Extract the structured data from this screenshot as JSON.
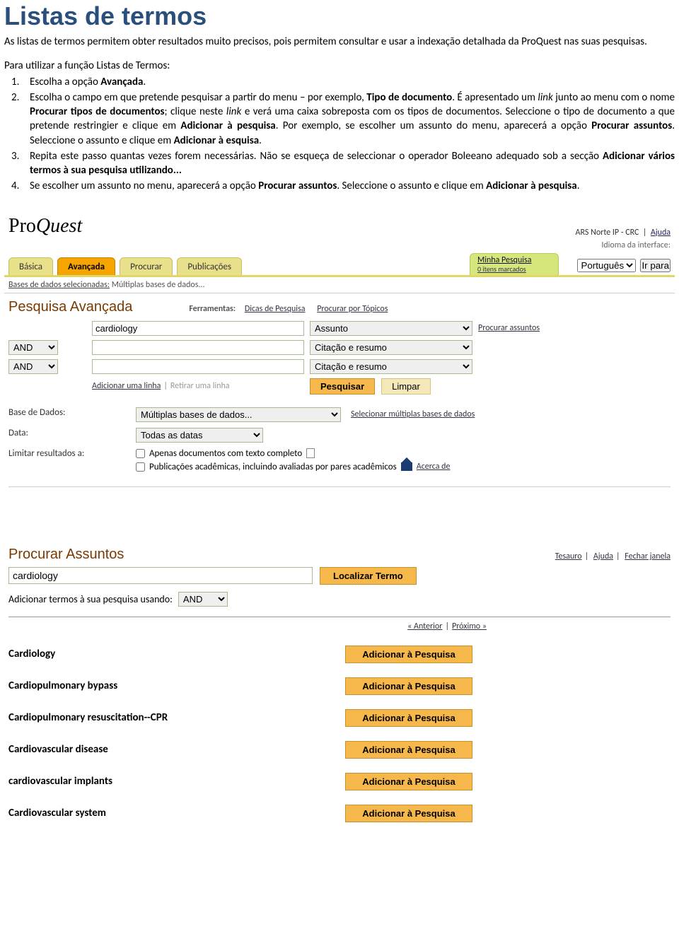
{
  "doc": {
    "title": "Listas de termos",
    "intro": "As listas de termos permitem obter resultados muito precisos, pois permitem consultar e usar a indexação detalhada da ProQuest nas suas pesquisas.",
    "lead": "Para utilizar a função Listas de Termos:",
    "steps": {
      "s1_a": "Escolha a opção ",
      "s1_b": "Avançada",
      "s1_c": ".",
      "s2_a": "Escolha o campo em que pretende pesquisar a partir do menu – por exemplo, ",
      "s2_b": "Tipo de documento",
      "s2_c": ". É apresentado um ",
      "s2_d": "link",
      "s2_e": " junto ao menu com o nome ",
      "s2_f": "Procurar tipos de documentos",
      "s2_g": "; clique neste ",
      "s2_g2": "link",
      "s2_h": " e verá uma caixa sobreposta com os tipos de documentos. Seleccione o tipo de documento a que pretende restringier e clique em ",
      "s2_i": "Adicionar à pesquisa",
      "s2_j": ". Por exemplo, se escolher um assunto do menu, aparecerá a opção ",
      "s2_k": "Procurar assuntos",
      "s2_l": ". Seleccione o assunto e clique em ",
      "s2_m": "Adicionar à esquisa",
      "s2_n": ".",
      "s3_a": "Repita este passo quantas vezes forem necessárias. Não se esqueça de seleccionar o operador Boleeano adequado sob a secção ",
      "s3_b": "Adicionar vários termos à sua pesquisa utilizando...",
      "s4_a": "Se escolher um assunto no menu, aparecerá a opção ",
      "s4_b": "Procurar assuntos",
      "s4_c": ". Seleccione o assunto e clique em ",
      "s4_d": "Adicionar à pesquisa",
      "s4_e": "."
    }
  },
  "pq": {
    "logo_a": "Pro",
    "logo_b": "Quest",
    "toplinks": {
      "org": "ARS Norte IP - CRC",
      "help": "Ajuda"
    },
    "lang": {
      "label": "Idioma da interface:",
      "value": "Português",
      "go": "Ir para"
    },
    "tabs": {
      "basica": "Básica",
      "avancada": "Avançada",
      "procurar": "Procurar",
      "pub": "Publicações"
    },
    "myresearch": {
      "title": "Minha Pesquisa",
      "sub": "0 itens marcados"
    },
    "dbbar_a": "Bases de dados selecionadas:",
    "dbbar_b": " Múltiplas bases de dados...",
    "h2": "Pesquisa Avançada",
    "tools": {
      "label": "Ferramentas:",
      "dicas": "Dicas de Pesquisa",
      "topicos": "Procurar por Tópicos"
    },
    "row1": {
      "term": "cardiology",
      "field": "Assunto",
      "link": "Procurar assuntos"
    },
    "row2": {
      "op": "AND",
      "field": "Citação e resumo"
    },
    "row3": {
      "op": "AND",
      "field": "Citação e resumo"
    },
    "addline": "Adicionar uma linha",
    "remline": "Retirar uma linha",
    "btn_search": "Pesquisar",
    "btn_clear": "Limpar",
    "filters": {
      "db_label": "Base de Dados:",
      "db_val": "Múltiplas bases de dados...",
      "db_link": "Selecionar múltiplas bases de dados",
      "date_label": "Data:",
      "date_val": "Todas as datas",
      "limit_label": "Limitar resultados a:",
      "chk1": "Apenas documentos com texto completo",
      "chk2": "Publicações acadêmicas, incluindo avaliadas por pares acadêmicos",
      "about": "Acerca de"
    }
  },
  "pa": {
    "h": "Procurar Assuntos",
    "links": {
      "tesauro": "Tesauro",
      "ajuda": "Ajuda",
      "fechar": "Fechar janela"
    },
    "term": "cardiology",
    "find": "Localizar Termo",
    "addlabel": "Adicionar termos à sua pesquisa usando:",
    "op": "AND",
    "nav": {
      "prev": "« Anterior",
      "next": "Próximo »"
    },
    "addbtn": "Adicionar à Pesquisa",
    "items": [
      "Cardiology",
      "Cardiopulmonary bypass",
      "Cardiopulmonary resuscitation--CPR",
      "Cardiovascular disease",
      "cardiovascular implants",
      "Cardiovascular system"
    ]
  }
}
